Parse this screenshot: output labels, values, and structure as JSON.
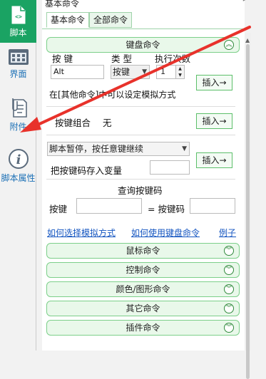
{
  "sidebar": {
    "items": [
      {
        "label": "脚本",
        "icon": "script-file-icon",
        "active": true
      },
      {
        "label": "界面",
        "icon": "interface-window-icon",
        "active": false
      },
      {
        "label": "附件",
        "icon": "attachment-clip-icon",
        "active": false
      },
      {
        "label": "脚本属性",
        "icon": "info-icon",
        "active": false
      }
    ]
  },
  "panel": {
    "title": "基本命令",
    "pin": "ᵖ",
    "tabs": [
      {
        "label": "基本命令",
        "active": true
      },
      {
        "label": "全部命令",
        "active": false
      }
    ]
  },
  "keyboard": {
    "header": "键盘命令",
    "col_key": "按 键",
    "col_type": "类 型",
    "col_times": "执行次数",
    "key_value": "Alt",
    "type_value": "按键",
    "times_value": "1",
    "insert_label": "插入→",
    "note": "在[其他命令]中可以设定模拟方式",
    "combo_label": "按键组合",
    "combo_value": "无",
    "pause_option": "脚本暂停，按任意键继续",
    "save_key_label": "把按键码存入变量",
    "query_title": "查询按键码",
    "query_key_label": "按键",
    "query_code_label": "= 按键码"
  },
  "links": {
    "how_sim": "如何选择模拟方式",
    "how_use": "如何使用键盘命令",
    "example": "例子"
  },
  "sections": [
    {
      "label": "鼠标命令"
    },
    {
      "label": "控制命令"
    },
    {
      "label": "颜色/图形命令"
    },
    {
      "label": "其它命令"
    },
    {
      "label": "插件命令"
    }
  ],
  "colors": {
    "accent": "#1aa363",
    "section_bg": "#e9f8ea",
    "section_border": "#7ccf89",
    "arrow": "#e8322b"
  }
}
